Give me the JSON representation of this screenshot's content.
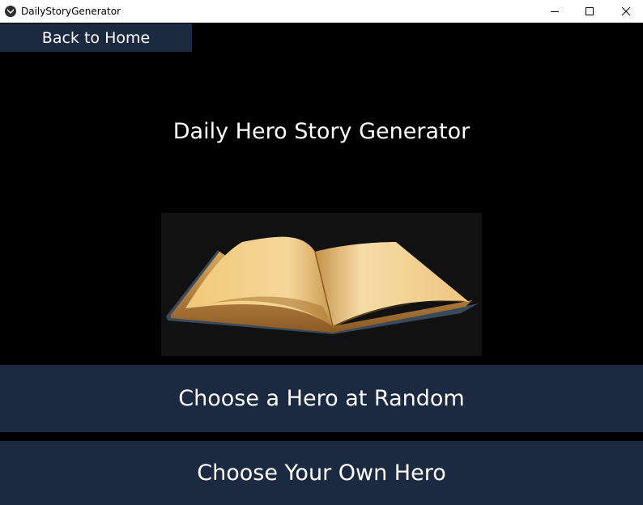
{
  "window": {
    "title": "DailyStoryGenerator",
    "icon": "kivy-app-icon",
    "controls": [
      "minimize-icon",
      "maximize-icon",
      "close-icon"
    ]
  },
  "nav": {
    "back_label": "Back to Home"
  },
  "main": {
    "title": "Daily Hero Story Generator",
    "image": "open-book-image"
  },
  "actions": {
    "random_label": "Choose a Hero at Random",
    "own_label": "Choose Your Own Hero"
  },
  "colors": {
    "background": "#000000",
    "button_bg": "#1b2a41",
    "text": "#ffffff",
    "image_bg": "#111111"
  }
}
